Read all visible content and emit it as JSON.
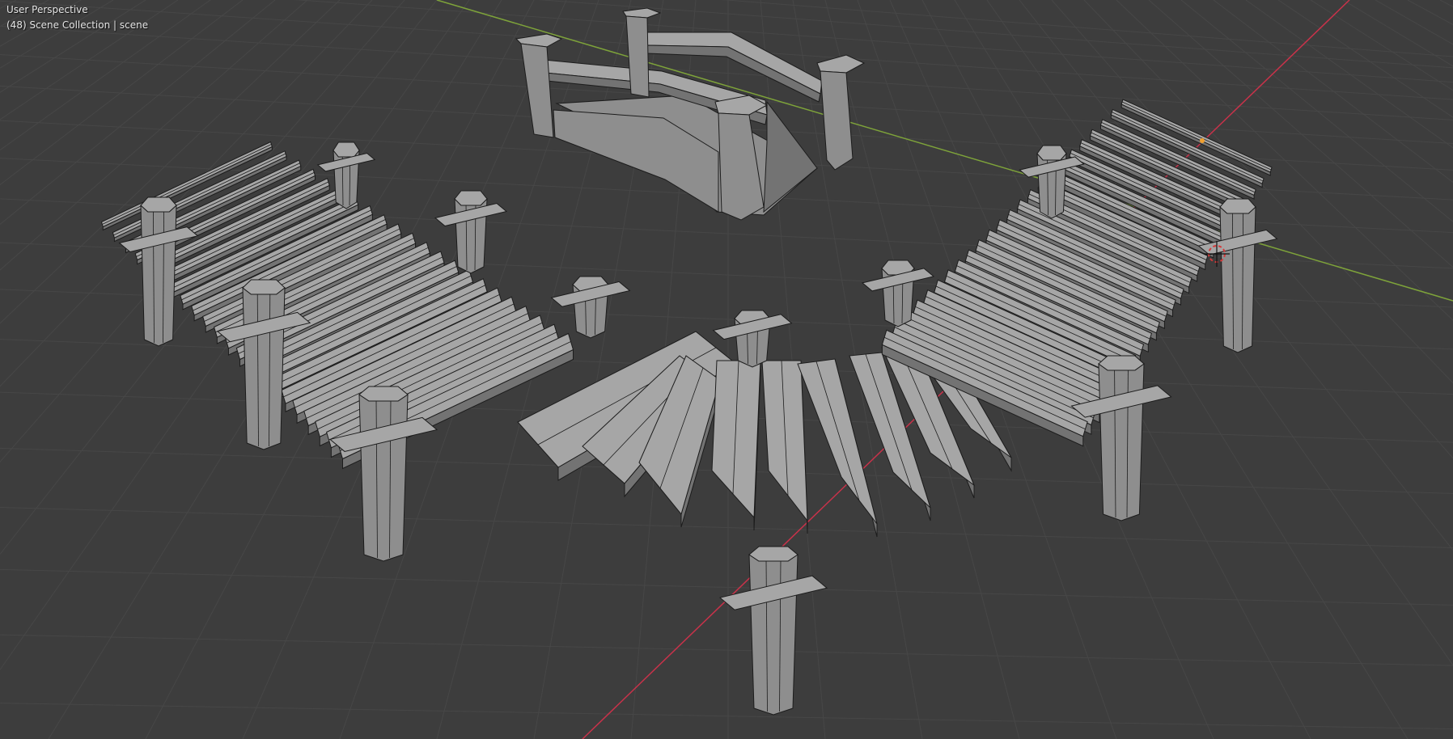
{
  "app": "Blender",
  "viewport": {
    "perspective_label": "User Perspective",
    "collection_label": "(48) Scene Collection | scene"
  },
  "colors": {
    "background": "#3d3d3d",
    "grid_line": "#474747",
    "grid_line_major": "#505050",
    "x_axis": "#c9324a",
    "y_axis": "#7ea33a",
    "mesh_light": "#a6a6a6",
    "mesh_mid": "#8e8e8e",
    "mesh_dark": "#737373",
    "wire": "#1c1c1c",
    "cursor": "#d43a3a",
    "origin_dot": "#f0a030"
  },
  "objects": [
    {
      "name": "arched-bridge",
      "kind": "mesh"
    },
    {
      "name": "plank-walkway-left",
      "kind": "mesh"
    },
    {
      "name": "plank-walkway-center",
      "kind": "mesh"
    },
    {
      "name": "plank-walkway-right",
      "kind": "mesh"
    },
    {
      "name": "support-posts",
      "kind": "mesh"
    }
  ],
  "icons": {
    "cursor": "3d-cursor-icon",
    "origin": "object-origin-icon"
  }
}
